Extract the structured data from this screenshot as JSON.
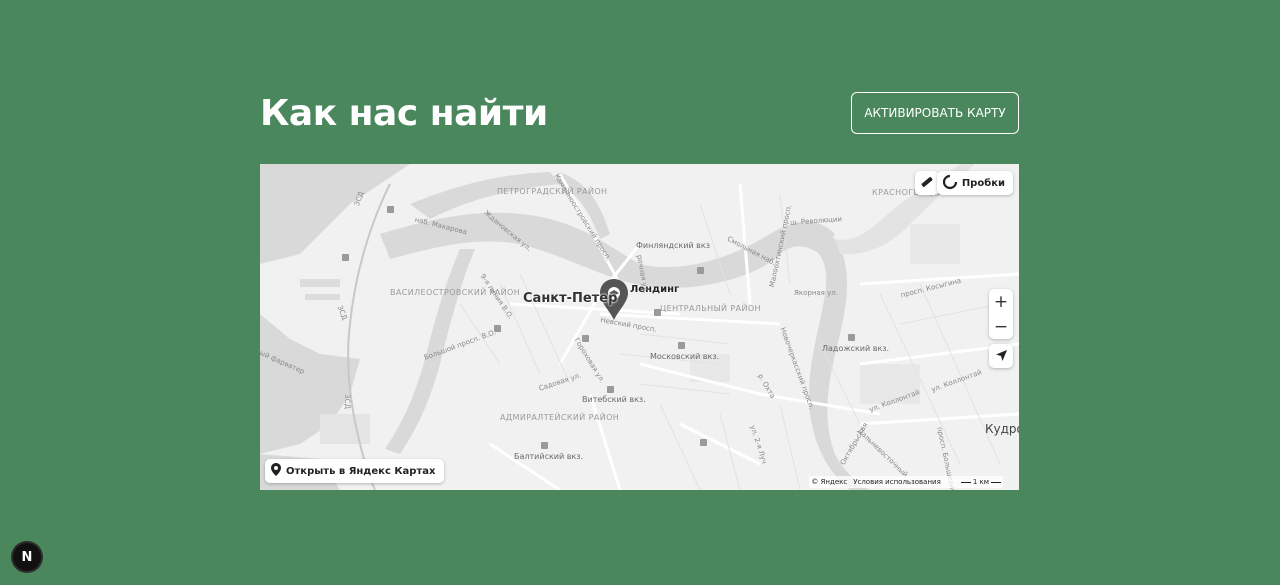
{
  "section": {
    "title": "Как нас найти",
    "activate_button": "АКТИВИРОВАТЬ КАРТУ"
  },
  "map": {
    "traffic_label": "Пробки",
    "open_in_yandex": "Открыть в Яндекс Картах",
    "copyright": "© Яндекс",
    "terms": "Условия использования",
    "scale_label": "1 км",
    "zoom_in": "+",
    "zoom_out": "−",
    "marker_label": "Лендинг",
    "city_label": "Санкт-Петер",
    "districts": {
      "petrogradsky": "ПЕТРОГРАДСКИЙ РАЙОН",
      "vasileostrovsky": "ВАСИЛЕОСТРОВСКИЙ РАЙОН",
      "central": "ЦЕНТРАЛЬНЫЙ РАЙОН",
      "admiralteysky": "АДМИРАЛТЕЙСКИЙ РАЙОН",
      "krasnogvardeysky": "КРАСНОГВАРДЕЙСКИЙ РАЙОН"
    },
    "stations": {
      "finlyandsky": "Финляндский вкз",
      "moskovsky": "Московский вкз.",
      "vitebsky": "Витебский вкз.",
      "baltiysky": "Балтийский вкз.",
      "ladozhsky": "Ладожский вкз."
    },
    "streets": {
      "makarova": "наб. Макарова",
      "nevsky": "Невский просп.",
      "sadovaya": "Садовая ул.",
      "gorokhovaya": "Гороховая ул.",
      "bolshoy_vo": "Большой просп. В.О.",
      "yakornaya": "Якорная ул.",
      "kosygina": "просп. Косыгина",
      "sh_revolyutsii": "ш. Революции",
      "smolnaya": "Смольная наб.",
      "kolontai_1": "ул. Коллонтай",
      "kolontai_2": "ул. Коллонтай",
      "zsd_1": "ЗСД",
      "zsd_2": "ЗСД",
      "zsd_3": "ЗСД",
      "kamennoostrovsky": "Каменноостровский просп.",
      "zhdanovskaya": "Ждановская ул.",
      "line_9": "9-я линия В.О.",
      "malookhtinsky": "Малоохтинский просп.",
      "novocherkassky": "Новочеркасский просп.",
      "bolshevikov": "просп. Большевиков",
      "dalnevostochny": "Дальневосточный",
      "oktyabrskaya": "Октябрьская",
      "ul_2_ya": "ул. 2-я Луч",
      "kudro": "Кудро",
      "fairway": "ый фарватер",
      "rochnaya": "рочная ул.",
      "r_okhta": "р. Охта"
    }
  },
  "next_badge": "N",
  "colors": {
    "background": "#4a875c",
    "map_land": "#f1f1f1",
    "map_water": "#d9d9d9",
    "text_light": "#ffffff"
  }
}
